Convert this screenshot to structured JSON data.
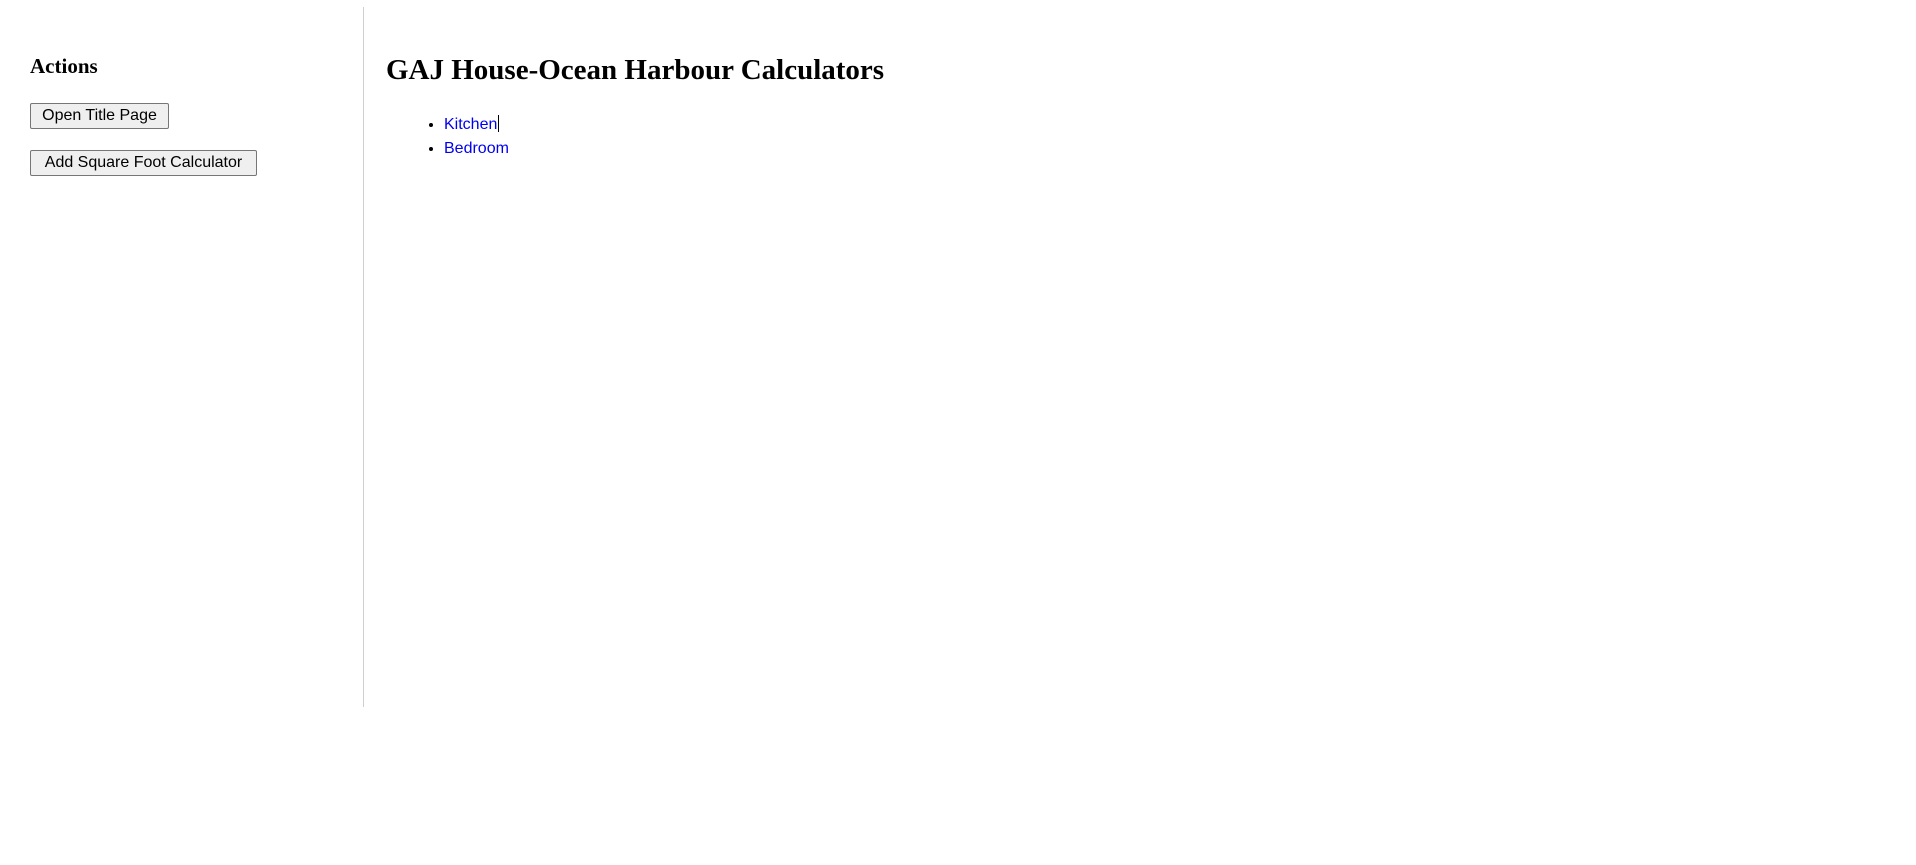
{
  "sidebar": {
    "heading": "Actions",
    "buttons": [
      {
        "label": "Open Title Page"
      },
      {
        "label": "Add Square Foot Calculator"
      }
    ]
  },
  "main": {
    "title": "GAJ House-Ocean Harbour Calculators",
    "links": [
      {
        "label": "Kitchen"
      },
      {
        "label": "Bedroom"
      }
    ]
  },
  "colors": {
    "link": "#0000ee",
    "divider": "#cfcfcf",
    "button_bg": "#efefef"
  }
}
